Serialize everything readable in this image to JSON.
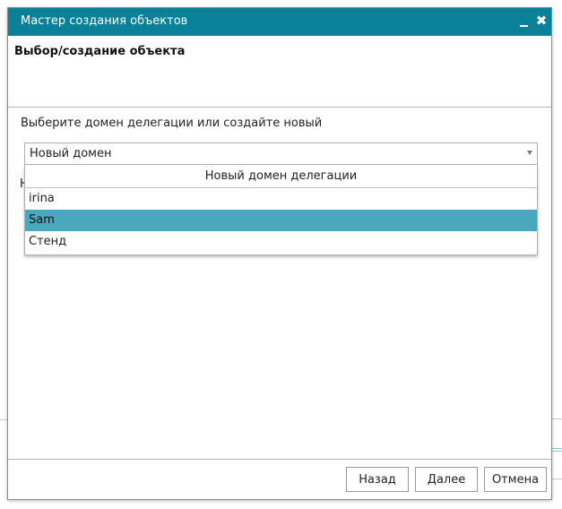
{
  "window": {
    "title": "Мастер создания объектов",
    "minimize_label": "_",
    "close_label": "✖"
  },
  "page": {
    "title": "Выбор/создание объекта"
  },
  "form": {
    "prompt": "Выберите домен делегации или создайте новый",
    "select": {
      "value": "Новый домен",
      "options_header": "Новый домен делегации",
      "options": [
        "irina",
        "Sam",
        "Стенд"
      ],
      "highlighted": "Sam"
    },
    "obscured_label_initial": "Н"
  },
  "footer": {
    "back": "Назад",
    "next": "Далее",
    "cancel": "Отмена"
  },
  "colors": {
    "titlebar": "#0a8099",
    "highlight": "#4aa8bd"
  }
}
